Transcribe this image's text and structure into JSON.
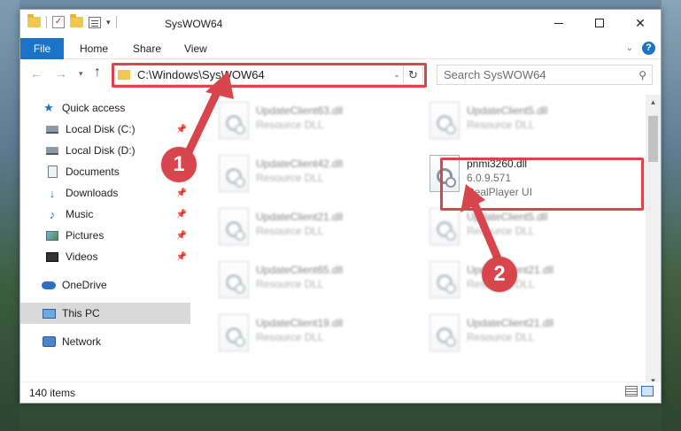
{
  "window": {
    "title": "SysWOW64"
  },
  "ribbon": {
    "tabs": [
      "File",
      "Home",
      "Share",
      "View"
    ]
  },
  "navbar": {
    "address": "C:\\Windows\\SysWOW64",
    "search_placeholder": "Search SysWOW64"
  },
  "sidebar": {
    "items": [
      {
        "label": "Quick access",
        "icon": "star-icon",
        "pinned": false
      },
      {
        "label": "Local Disk (C:)",
        "icon": "drive-icon",
        "pinned": true
      },
      {
        "label": "Local Disk (D:)",
        "icon": "drive-icon",
        "pinned": false
      },
      {
        "label": "Documents",
        "icon": "documents-icon",
        "pinned": true
      },
      {
        "label": "Downloads",
        "icon": "download-arrow-icon",
        "pinned": true
      },
      {
        "label": "Music",
        "icon": "music-note-icon",
        "pinned": true
      },
      {
        "label": "Pictures",
        "icon": "pictures-icon",
        "pinned": true
      },
      {
        "label": "Videos",
        "icon": "film-icon",
        "pinned": true
      },
      {
        "label": "OneDrive",
        "icon": "cloud-icon",
        "pinned": false
      },
      {
        "label": "This PC",
        "icon": "monitor-icon",
        "pinned": false,
        "selected": true
      },
      {
        "label": "Network",
        "icon": "network-icon",
        "pinned": false
      }
    ]
  },
  "files": {
    "left_column": [
      {
        "name": "UpdateClient63.dll",
        "type": "Resource DLL"
      },
      {
        "name": "UpdateClient42.dll",
        "type": "Resource DLL"
      },
      {
        "name": "UpdateClient21.dll",
        "type": "Resource DLL"
      },
      {
        "name": "UpdateClient65.dll",
        "type": "Resource DLL"
      },
      {
        "name": "UpdateClient19.dll",
        "type": "Resource DLL"
      }
    ],
    "right_column": [
      {
        "name": "UpdateClient5.dll",
        "type": "Resource DLL"
      },
      {
        "name": "UpdateClient5.dll",
        "type": "Resource DLL"
      },
      {
        "name": "UpdateClient21.dll",
        "type": "Resource DLL"
      },
      {
        "name": "UpdateClient21.dll",
        "type": "Resource DLL"
      }
    ],
    "highlighted": {
      "name": "pnmi3260.dll",
      "version": "6.0.9.571",
      "description": "RealPlayer UI"
    }
  },
  "status": {
    "item_count": "140 items"
  },
  "callouts": {
    "step1": "1",
    "step2": "2"
  },
  "colors": {
    "accent": "#1a73c8",
    "highlight": "#d9454d",
    "folder": "#f0c654"
  }
}
